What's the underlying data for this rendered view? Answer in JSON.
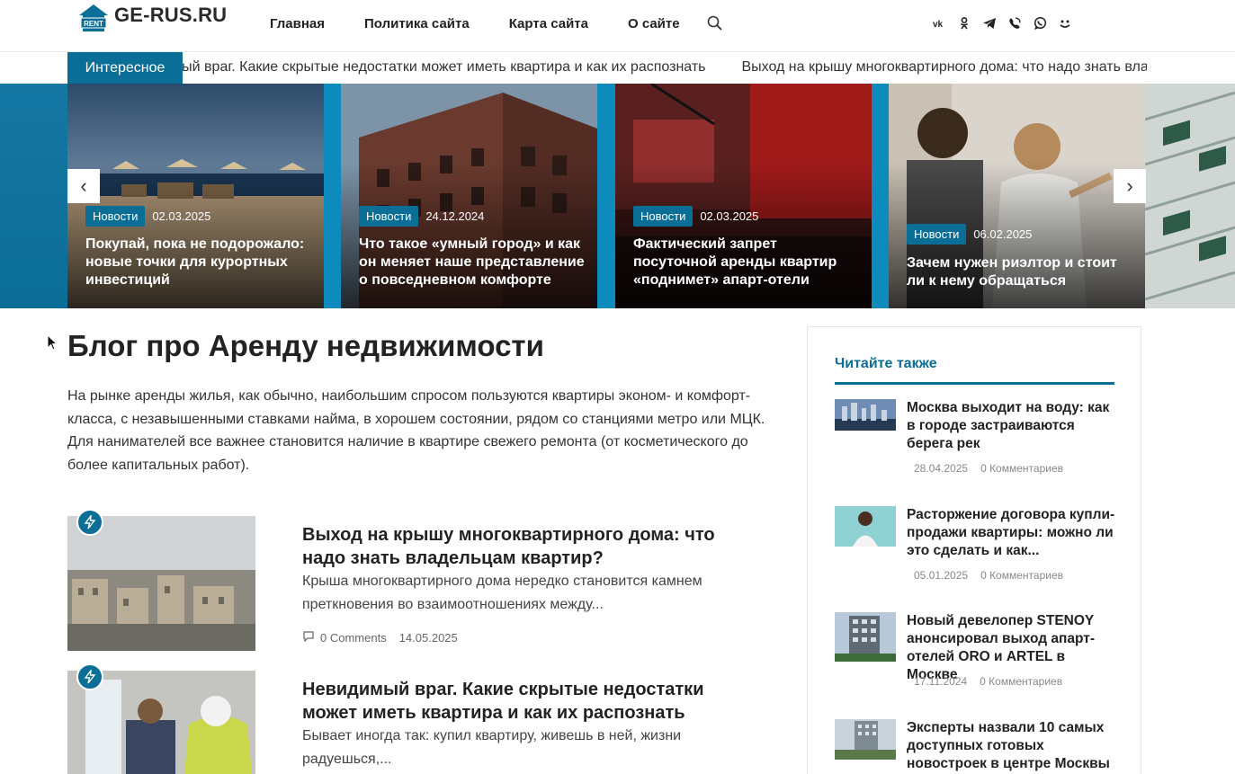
{
  "site": {
    "logo_text": "GE-RUS.RU",
    "logo_badge": "RENT"
  },
  "nav": [
    "Главная",
    "Политика сайта",
    "Карта сайта",
    "О сайте"
  ],
  "socials": [
    "vk-icon",
    "odnoklassniki-icon",
    "telegram-icon",
    "viber-icon",
    "whatsapp-icon",
    "moimir-icon"
  ],
  "ticker": {
    "label": "Интересное",
    "items": [
      "Невидимый враг. Какие скрытые недостатки может иметь квартира и как их распознать",
      "Выход на крышу многоквартирного дома: что надо знать владельцам квартир?"
    ]
  },
  "slider": {
    "prev": "‹",
    "next": "›",
    "slides": [
      {
        "badge": "Новости",
        "date": "02.03.2025",
        "title": "Покупай, пока не подорожало: новые точки для курортных инвестиций"
      },
      {
        "badge": "Новости",
        "date": "24.12.2024",
        "title": "Что такое «умный город» и как он меняет наше представление о повседневном комфорте"
      },
      {
        "badge": "Новости",
        "date": "02.03.2025",
        "title": "Фактический запрет посуточной аренды квартир «поднимет» апарт-отели"
      },
      {
        "badge": "Новости",
        "date": "06.02.2025",
        "title": "Зачем нужен риэлтор и стоит ли к нему обращаться"
      }
    ]
  },
  "main": {
    "title": "Блог про Аренду недвижимости",
    "intro": "На рынке аренды жилья, как обычно, наибольшим спросом пользуются квартиры эконом- и комфорт-класса, с незавышенными ставками найма, в хорошем состоянии, рядом со станциями метро или МЦК. Для нанимателей все важнее становится наличие в квартире свежего ремонта (от косметического до более капитальных работ).",
    "posts": [
      {
        "title": "Выход на крышу многоквартирного дома: что надо знать владельцам квартир?",
        "excerpt": "Крыша многоквартирного дома нередко становится камнем преткновения во взаимоотношениях между...",
        "comments": "0 Comments",
        "date": "14.05.2025"
      },
      {
        "title": "Невидимый враг. Какие скрытые недостатки может иметь квартира и как их распознать",
        "excerpt": "Бывает иногда так: купил квартиру, живешь в ней, жизни радуешься,...",
        "comments": "",
        "date": ""
      }
    ]
  },
  "sidebar": {
    "heading": "Читайте также",
    "items": [
      {
        "title": "Москва выходит на воду: как в городе застраиваются берега рек",
        "date": "28.04.2025",
        "comments": "0 Комментариев"
      },
      {
        "title": "Расторжение договора купли-продажи квартиры: можно ли это сделать и как...",
        "date": "05.01.2025",
        "comments": "0 Комментариев"
      },
      {
        "title": "Новый девелопер STENOY анонсировал выход апарт-отелей ORO и ARTEL в Москве",
        "date": "17.11.2024",
        "comments": "0 Комментариев"
      },
      {
        "title": "Эксперты назвали 10 самых доступных готовых новостроек в центре Москвы",
        "date": "",
        "comments": ""
      }
    ]
  },
  "colors": {
    "accent": "#0b6e96",
    "slider_bg": "#0e8bbd"
  }
}
